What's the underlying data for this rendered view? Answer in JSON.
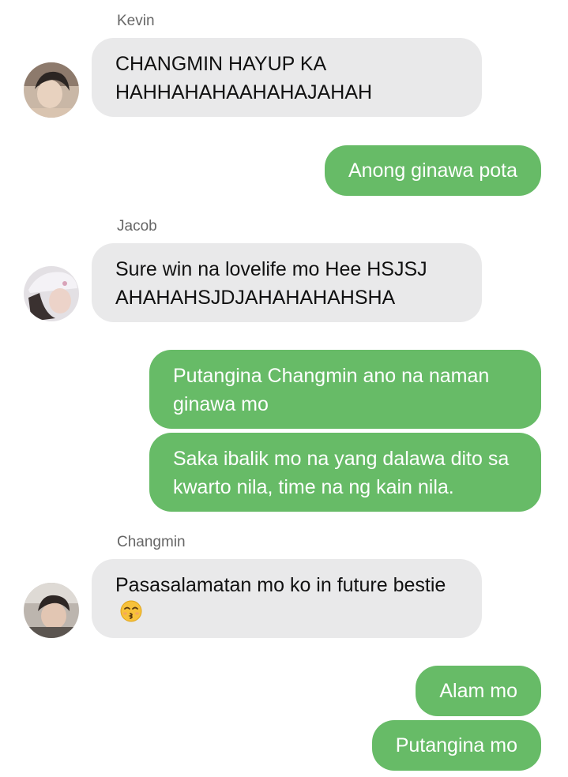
{
  "messages": [
    {
      "type": "in",
      "sender": "Kevin",
      "avatar_icon": "user-avatar-kevin",
      "text": "CHANGMIN HAYUP KA HAHHAHAHAAHAHAJAHAH"
    },
    {
      "type": "out",
      "text": "Anong ginawa pota"
    },
    {
      "type": "in",
      "sender": "Jacob",
      "avatar_icon": "user-avatar-jacob",
      "text": "Sure win na lovelife mo Hee HSJSJ AHAHAHSJDJAHAHAHAHSHA"
    },
    {
      "type": "out",
      "text": "Putangina Changmin ano na naman ginawa mo"
    },
    {
      "type": "out",
      "text": "Saka ibalik mo na yang dalawa dito sa kwarto nila, time na ng kain nila."
    },
    {
      "type": "in",
      "sender": "Changmin",
      "avatar_icon": "user-avatar-changmin",
      "text": "Pasasalamatan mo ko in future bestie",
      "emoji_icon": "kissing-face-emoji-icon"
    },
    {
      "type": "out",
      "text": "Alam mo"
    },
    {
      "type": "out",
      "text": "Putangina mo"
    }
  ],
  "colors": {
    "incoming_bubble": "#e9e9ea",
    "outgoing_bubble": "#67bb67",
    "outgoing_text": "#ffffff",
    "sender_name": "#666666"
  }
}
